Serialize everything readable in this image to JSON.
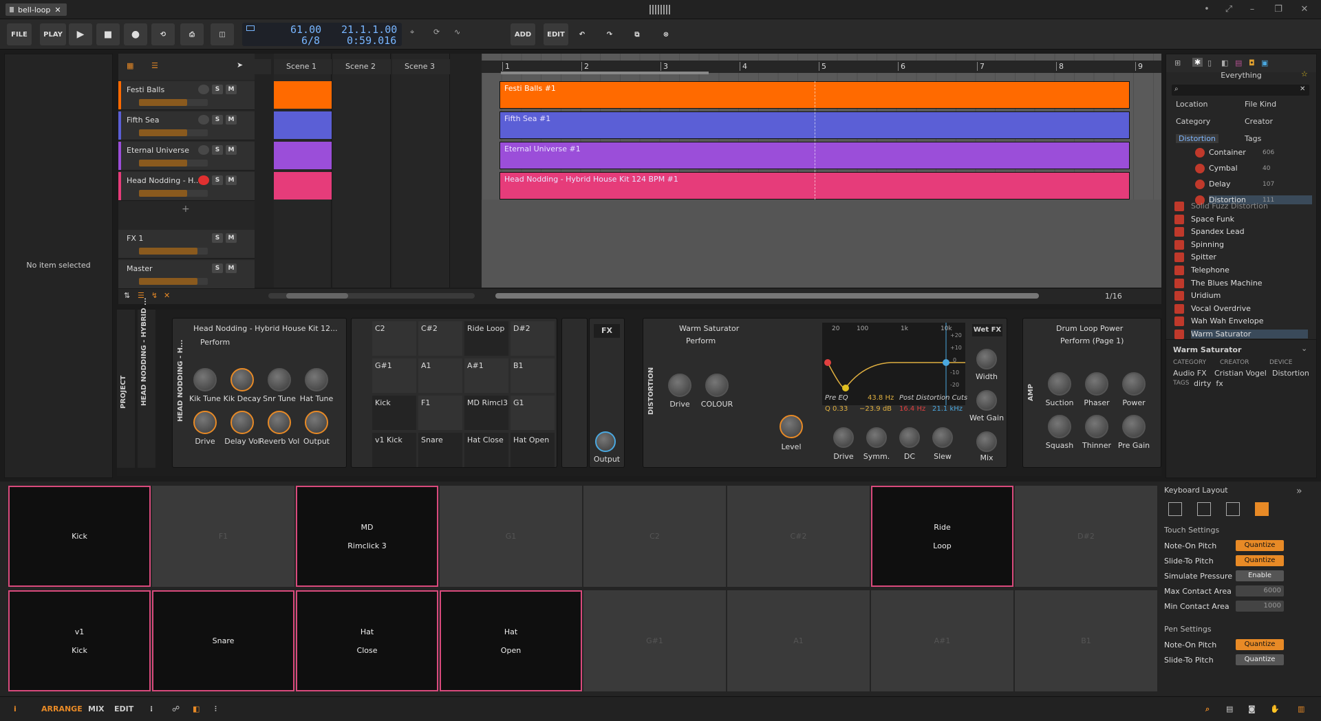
{
  "window": {
    "tab_title": "bell-loop"
  },
  "toolbar": {
    "file": "FILE",
    "play_label": "PLAY",
    "add": "ADD",
    "edit": "EDIT",
    "tempo": "61.00",
    "signature": "6/8",
    "position": "21.1.1.00",
    "time": "0:59.016"
  },
  "inspector": {
    "empty": "No item selected"
  },
  "tracks": [
    {
      "name": "Festi Balls",
      "color": "#ff6a00"
    },
    {
      "name": "Fifth Sea",
      "color": "#5b5fd6"
    },
    {
      "name": "Eternal Universe",
      "color": "#9b4ed9"
    },
    {
      "name": "Head Nodding - H...",
      "color": "#e63c7a"
    }
  ],
  "fx_tracks": [
    {
      "name": "FX 1"
    },
    {
      "name": "Master"
    }
  ],
  "scenes": [
    "Scene 1",
    "Scene 2",
    "Scene 3"
  ],
  "ruler": [
    "1",
    "2",
    "3",
    "4",
    "5",
    "6",
    "7",
    "8",
    "9"
  ],
  "clips": [
    {
      "name": "Festi Balls #1",
      "color": "#ff6a00"
    },
    {
      "name": "Fifth Sea #1",
      "color": "#5b5fd6"
    },
    {
      "name": "Eternal Universe #1",
      "color": "#9b4ed9"
    },
    {
      "name": "Head Nodding - Hybrid House Kit 124 BPM #1",
      "color": "#e63c7a"
    }
  ],
  "arranger_footer": {
    "grid": "1/16"
  },
  "device_chain": {
    "side_labels": {
      "project": "PROJECT",
      "track": "HEAD NODDING - HYBRID ...",
      "instrument": "HEAD NODDING - H..."
    },
    "drum": {
      "title": "Head Nodding - Hybrid House Kit 12...",
      "preset": "Perform",
      "knobs": [
        "Kik Tune",
        "Kik Decay",
        "Snr Tune",
        "Hat Tune",
        "Drive",
        "Delay Vol",
        "Reverb Vol",
        "Output"
      ]
    },
    "pads": [
      [
        "C2",
        "C#2",
        "Ride Loop",
        "D#2"
      ],
      [
        "G#1",
        "A1",
        "A#1",
        "B1"
      ],
      [
        "Kick",
        "F1",
        "MD Rimcl3",
        "G1"
      ],
      [
        "v1 Kick",
        "Snare",
        "Hat Close",
        "Hat Open"
      ]
    ],
    "fx_label": "FX",
    "output_label": "Output",
    "distortion": {
      "side": "DISTORTION",
      "title": "Warm Saturator",
      "preset": "Perform",
      "knobs": [
        "Drive",
        "COLOUR",
        "Level"
      ],
      "eq": {
        "ticks": [
          "20",
          "100",
          "1k",
          "10k"
        ],
        "db": [
          "+20",
          "+10",
          "0",
          "-10",
          "-20"
        ],
        "pre": "Pre EQ",
        "freq": "43.8 Hz",
        "post": "Post Distortion Cuts",
        "q": "Q 0.33",
        "gain": "−23.9 dB",
        "lo": "16.4 Hz",
        "hi": "21.1 kHz"
      },
      "lower_knobs": [
        "Drive",
        "Symm.",
        "DC",
        "Slew"
      ],
      "wet": "Wet FX",
      "right_knobs": [
        "Width",
        "Wet Gain",
        "Mix"
      ]
    },
    "amp": {
      "side": "AMP",
      "title": "Drum Loop Power",
      "preset": "Perform (Page 1)",
      "knobs": [
        "Suction",
        "Phaser",
        "Power",
        "Squash",
        "Thinner",
        "Pre Gain"
      ]
    }
  },
  "browser": {
    "title": "Everything",
    "filters": [
      "Location",
      "File Kind",
      "Category",
      "Creator",
      "Distortion",
      "Tags"
    ],
    "categories": [
      {
        "name": "Container",
        "count": "606"
      },
      {
        "name": "Cymbal",
        "count": "40"
      },
      {
        "name": "Delay",
        "count": "107"
      },
      {
        "name": "Distortion",
        "count": "111"
      }
    ],
    "results": [
      "Solid Fuzz Distortion",
      "Space Funk",
      "Spandex Lead",
      "Spinning",
      "Spitter",
      "Telephone",
      "The Blues Machine",
      "Uridium",
      "Vocal Overdrive",
      "Wah Wah Envelope",
      "Warm Saturator"
    ],
    "detail": {
      "name": "Warm Saturator",
      "h_category": "CATEGORY",
      "h_creator": "CREATOR",
      "h_device": "DEVICE",
      "category": "Audio FX",
      "creator": "Cristian Vogel",
      "device": "Distortion",
      "tags_label": "TAGS",
      "tags": "dirty  fx"
    }
  },
  "padgrid": [
    {
      "l1": "Kick",
      "l2": "",
      "on": true
    },
    {
      "l1": "F1",
      "l2": "",
      "on": false
    },
    {
      "l1": "MD",
      "l2": "Rimclick 3",
      "on": true
    },
    {
      "l1": "G1",
      "l2": "",
      "on": false
    },
    {
      "l1": "C2",
      "l2": "",
      "on": false
    },
    {
      "l1": "C#2",
      "l2": "",
      "on": false
    },
    {
      "l1": "Ride",
      "l2": "Loop",
      "on": true
    },
    {
      "l1": "D#2",
      "l2": "",
      "on": false
    },
    {
      "l1": "v1",
      "l2": "Kick",
      "on": true
    },
    {
      "l1": "Snare",
      "l2": "",
      "on": true
    },
    {
      "l1": "Hat",
      "l2": "Close",
      "on": true
    },
    {
      "l1": "Hat",
      "l2": "Open",
      "on": true
    },
    {
      "l1": "G#1",
      "l2": "",
      "on": false
    },
    {
      "l1": "A1",
      "l2": "",
      "on": false
    },
    {
      "l1": "A#1",
      "l2": "",
      "on": false
    },
    {
      "l1": "B1",
      "l2": "",
      "on": false
    }
  ],
  "keyboard": {
    "title": "Keyboard Layout",
    "touch": "Touch Settings",
    "pen": "Pen Settings",
    "rows": [
      {
        "label": "Note-On Pitch",
        "value": "Quantize",
        "style": "orange"
      },
      {
        "label": "Slide-To Pitch",
        "value": "Quantize",
        "style": "orange"
      },
      {
        "label": "Simulate Pressure",
        "value": "Enable",
        "style": "gray"
      },
      {
        "label": "Max Contact Area",
        "value": "6000",
        "style": "num"
      },
      {
        "label": "Min Contact Area",
        "value": "1000",
        "style": "num"
      }
    ],
    "pen_rows": [
      {
        "label": "Note-On Pitch",
        "value": "Quantize",
        "style": "orange"
      },
      {
        "label": "Slide-To Pitch",
        "value": "Quantize",
        "style": "gray"
      }
    ]
  },
  "statusbar": {
    "arrange": "ARRANGE",
    "mix": "MIX",
    "edit": "EDIT"
  },
  "colors": {
    "accent": "#e88a26",
    "pad_border": "#d94a7c",
    "lcd_text": "#78b6ff"
  }
}
